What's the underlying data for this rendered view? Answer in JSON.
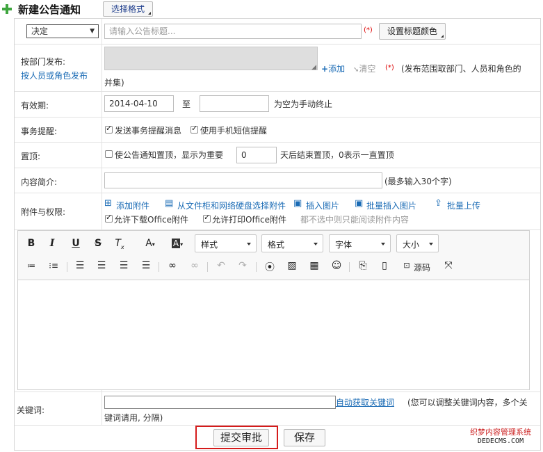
{
  "header": {
    "title": "新建公告通知",
    "format_button": "选择格式"
  },
  "title_row": {
    "type_select": "决定",
    "title_placeholder": "请输入公告标题...",
    "required": "(*)",
    "color_button": "设置标题颜色"
  },
  "publish_row": {
    "label": "按部门发布:",
    "alt_link": "按人员或角色发布",
    "add": "添加",
    "clear": "清空",
    "required": "(*)",
    "note_line1": "(发布范围取部门、人员和角色的",
    "note_line2": "并集)"
  },
  "validity_row": {
    "label": "有效期:",
    "start_date": "2014-04-10",
    "to": "至",
    "end_date": "",
    "hint": "为空为手动终止"
  },
  "reminder_row": {
    "label": "事务提醒:",
    "opt1": "发送事务提醒消息",
    "opt2": "使用手机短信提醒"
  },
  "top_row": {
    "label": "置顶:",
    "opt": "使公告通知置顶，显示为重要",
    "days": "0",
    "hint": "天后结束置顶，0表示一直置顶"
  },
  "summary_row": {
    "label": "内容简介:",
    "hint": "(最多输入30个字)"
  },
  "attach_row": {
    "label": "附件与权限:",
    "add_attach": "添加附件",
    "from_cabinet": "从文件柜和网络硬盘选择附件",
    "insert_image": "插入图片",
    "batch_insert_image": "批量插入图片",
    "batch_upload": "批量上传",
    "allow_download": "允许下载Office附件",
    "allow_print": "允许打印Office附件",
    "readonly_note": "都不选中则只能阅读附件内容"
  },
  "editor": {
    "style_dd": "样式",
    "format_dd": "格式",
    "font_dd": "字体",
    "size_dd": "大小",
    "source": "源码"
  },
  "keyword_row": {
    "label": "关键词:",
    "auto_link": "自动获取关键词",
    "hint_line1": "(您可以调整关键词内容，多个关",
    "hint_line2": "键词请用, 分隔)"
  },
  "actions": {
    "submit": "提交审批",
    "save": "保存"
  },
  "watermark": {
    "line1": "织梦内容管理系统",
    "line2": "DEDECMS.COM"
  }
}
